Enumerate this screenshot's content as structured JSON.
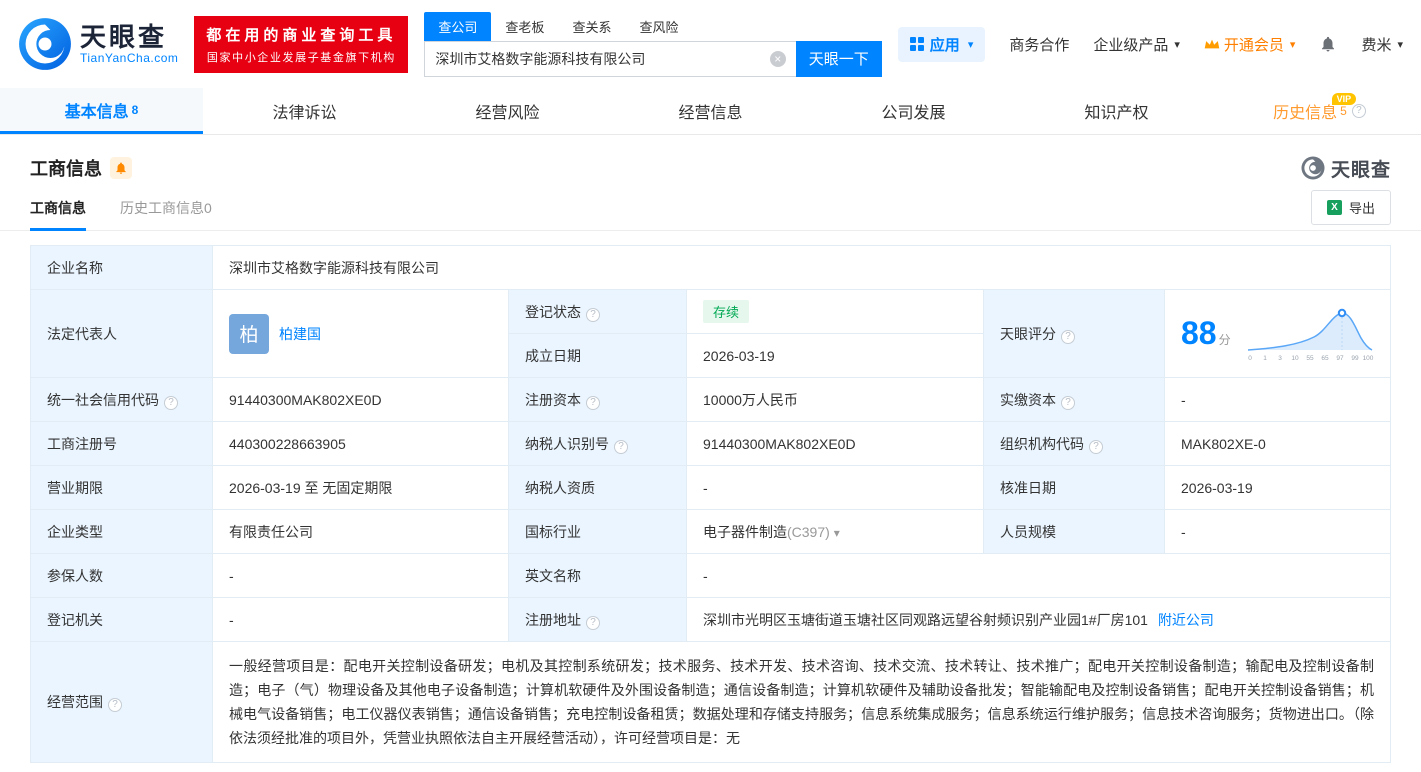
{
  "brand": {
    "name": "天眼查",
    "domain": "TianYanCha.com",
    "slogan1": "都在用的商业查询工具",
    "slogan2": "国家中小企业发展子基金旗下机构"
  },
  "colors": {
    "primary": "#0084ff",
    "badge_red": "#e60012",
    "history_orange": "#ff9a2e",
    "status_green": "#00a854"
  },
  "search": {
    "tabs": [
      "查公司",
      "查老板",
      "查关系",
      "查风险"
    ],
    "value": "深圳市艾格数字能源科技有限公司",
    "button": "天眼一下"
  },
  "topnav": {
    "apps": "应用",
    "cooperation": "商务合作",
    "enterprise": "企业级产品",
    "vip": "开通会员",
    "user": "费米"
  },
  "nav_tabs": {
    "basic": {
      "label": "基本信息",
      "count": "8"
    },
    "legal": {
      "label": "法律诉讼"
    },
    "risk": {
      "label": "经营风险"
    },
    "operation": {
      "label": "经营信息"
    },
    "development": {
      "label": "公司发展"
    },
    "ip": {
      "label": "知识产权"
    },
    "history": {
      "label": "历史信息",
      "count": "5",
      "vip": "VIP"
    }
  },
  "section": {
    "title": "工商信息",
    "subtab_current": "工商信息",
    "subtab_history": "历史工商信息0",
    "export_label": "导出",
    "watermark": "天眼查"
  },
  "info": {
    "company_name_label": "企业名称",
    "company_name": "深圳市艾格数字能源科技有限公司",
    "legal_rep_label": "法定代表人",
    "legal_rep_avatar": "柏",
    "legal_rep_name": "柏建国",
    "reg_status_label": "登记状态",
    "reg_status": "存续",
    "establish_label": "成立日期",
    "establish_date": "2026-03-19",
    "score_label": "天眼评分",
    "score_value": "88",
    "score_unit": "分",
    "credit_code_label": "统一社会信用代码",
    "credit_code": "91440300MAK802XE0D",
    "reg_capital_label": "注册资本",
    "reg_capital": "10000万人民币",
    "paid_capital_label": "实缴资本",
    "paid_capital": "-",
    "reg_no_label": "工商注册号",
    "reg_no": "440300228663905",
    "taxpayer_id_label": "纳税人识别号",
    "taxpayer_id": "91440300MAK802XE0D",
    "org_code_label": "组织机构代码",
    "org_code": "MAK802XE-0",
    "term_label": "营业期限",
    "term": "2026-03-19 至 无固定期限",
    "taxpayer_quality_label": "纳税人资质",
    "taxpayer_quality": "-",
    "approval_label": "核准日期",
    "approval_date": "2026-03-19",
    "type_label": "企业类型",
    "company_type": "有限责任公司",
    "industry_label": "国标行业",
    "industry": "电子器件制造",
    "industry_code": "(C397)",
    "staff_label": "人员规模",
    "staff": "-",
    "insured_label": "参保人数",
    "insured": "-",
    "en_name_label": "英文名称",
    "en_name": "-",
    "authority_label": "登记机关",
    "authority": "-",
    "address_label": "注册地址",
    "address": "深圳市光明区玉塘街道玉塘社区同观路远望谷射频识别产业园1#厂房101",
    "nearby_link": "附近公司",
    "scope_label": "经营范围",
    "scope": "一般经营项目是：配电开关控制设备研发；电机及其控制系统研发；技术服务、技术开发、技术咨询、技术交流、技术转让、技术推广；配电开关控制设备制造；输配电及控制设备制造；电子（气）物理设备及其他电子设备制造；计算机软硬件及外围设备制造；通信设备制造；计算机软硬件及辅助设备批发；智能输配电及控制设备销售；配电开关控制设备销售；机械电气设备销售；电工仪器仪表销售；通信设备销售；充电控制设备租赁；数据处理和存储支持服务；信息系统集成服务；信息系统运行维护服务；信息技术咨询服务；货物进出口。（除依法须经批准的项目外，凭营业执照依法自主开展经营活动），许可经营项目是：无"
  },
  "score_chart": {
    "type": "area",
    "score": 88,
    "x_ticks": [
      "0",
      "1",
      "3",
      "10",
      "55",
      "65",
      "97",
      "99",
      "100"
    ]
  }
}
